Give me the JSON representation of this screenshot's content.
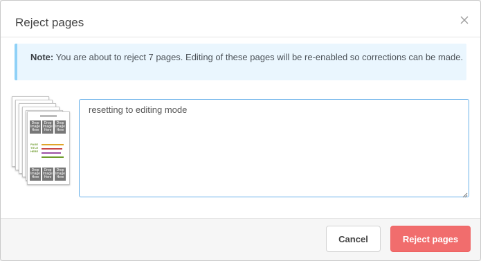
{
  "dialog": {
    "title": "Reject pages",
    "close_icon": "close-icon"
  },
  "note": {
    "label": "Note:",
    "text": " You are about to reject 7 pages. Editing of these pages will be re-enabled so corrections can be made."
  },
  "thumbnail": {
    "drop_label": "Drop Image Here",
    "mid_text": "PAGE TITLE HERE"
  },
  "comment": {
    "value": "resetting to editing mode"
  },
  "footer": {
    "cancel_label": "Cancel",
    "reject_label": "Reject pages"
  },
  "colors": {
    "accent_reject": "#f16d6d",
    "note_background": "#eaf6fe",
    "note_border": "#8fd1f7",
    "focus_border": "#66afe9"
  }
}
